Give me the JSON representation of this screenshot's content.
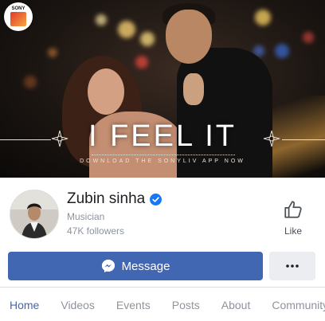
{
  "cover": {
    "brand_logo": "sony-liv-logo",
    "brand_text": "SONY",
    "title": "I FEEL IT",
    "subtitle": "DOWNLOAD THE SONYLIV APP NOW"
  },
  "profile": {
    "name": "Zubin sinha",
    "verified": true,
    "category": "Musician",
    "followers": "47K followers",
    "like_label": "Like"
  },
  "actions": {
    "message_label": "Message",
    "more_label": "•••"
  },
  "tabs": [
    {
      "label": "Home",
      "active": true
    },
    {
      "label": "Videos",
      "active": false
    },
    {
      "label": "Events",
      "active": false
    },
    {
      "label": "Posts",
      "active": false
    },
    {
      "label": "About",
      "active": false
    },
    {
      "label": "Community",
      "active": false
    }
  ],
  "colors": {
    "accent": "#4267b2",
    "verified_badge": "#1877f2",
    "muted_text": "#8d949e",
    "button_gray": "#ebedf0"
  }
}
